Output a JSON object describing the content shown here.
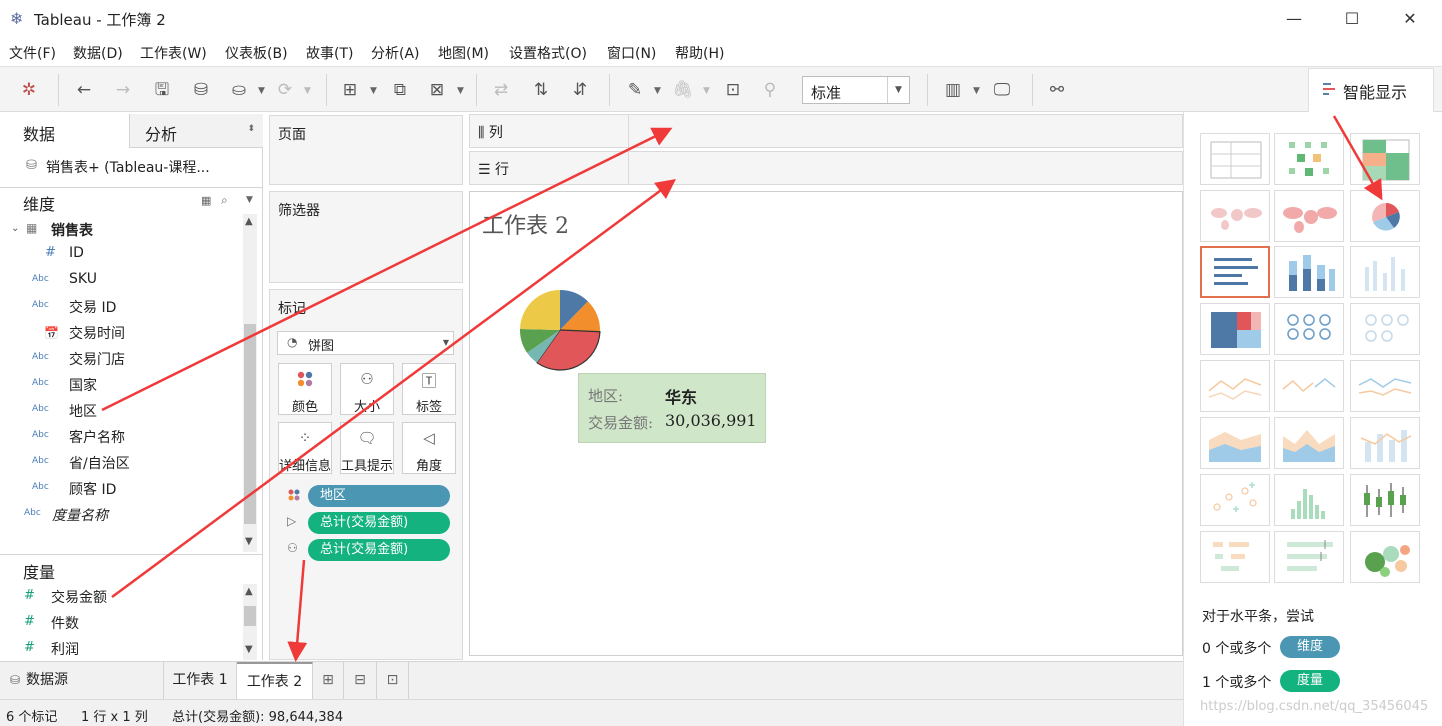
{
  "window": {
    "title": "Tableau - 工作簿 2",
    "minimize": "—",
    "maximize": "☐",
    "close": "✕"
  },
  "menu": [
    "文件(F)",
    "数据(D)",
    "工作表(W)",
    "仪表板(B)",
    "故事(T)",
    "分析(A)",
    "地图(M)",
    "设置格式(O)",
    "窗口(N)",
    "帮助(H)"
  ],
  "toolbar": {
    "fit_select": "标准",
    "smart_show": "智能显示"
  },
  "left": {
    "tab_data": "数据",
    "tab_analysis": "分析",
    "datasource": "销售表+ (Tableau-课程...",
    "dimensions_header": "维度",
    "table_name": "销售表",
    "dimensions": [
      {
        "type": "#",
        "name": "ID"
      },
      {
        "type": "Abc",
        "name": "SKU"
      },
      {
        "type": "Abc",
        "name": "交易 ID"
      },
      {
        "type": "date",
        "name": "交易时间"
      },
      {
        "type": "Abc",
        "name": "交易门店"
      },
      {
        "type": "Abc",
        "name": "国家"
      },
      {
        "type": "Abc",
        "name": "地区"
      },
      {
        "type": "Abc",
        "name": "客户名称"
      },
      {
        "type": "Abc",
        "name": "省/自治区"
      },
      {
        "type": "Abc",
        "name": "顾客 ID"
      }
    ],
    "measure_names": "度量名称",
    "measures_header": "度量",
    "measures": [
      "交易金额",
      "件数",
      "利润"
    ]
  },
  "shelves": {
    "pages": "页面",
    "filters": "筛选器",
    "marks": "标记",
    "mark_type": "饼图",
    "columns": "列",
    "rows": "行",
    "mark_buttons": [
      "颜色",
      "大小",
      "标签",
      "详细信息",
      "工具提示",
      "角度"
    ],
    "pills": [
      {
        "label": "地区",
        "color": "#4a96b3"
      },
      {
        "label": "总计(交易金额)",
        "color": "#14b27f"
      },
      {
        "label": "总计(交易金额)",
        "color": "#14b27f"
      }
    ]
  },
  "view": {
    "title": "工作表 2",
    "tooltip": {
      "label1": "地区:",
      "value1": "华东",
      "label2": "交易金额:",
      "value2": "30,036,991"
    }
  },
  "pie": {
    "slices": [
      {
        "name": "slice-blue",
        "value": 11,
        "color": "#4e79a7"
      },
      {
        "name": "slice-orange",
        "value": 12,
        "color": "#f28e2b"
      },
      {
        "name": "slice-red",
        "value": 30.5,
        "color": "#e15759"
      },
      {
        "name": "slice-teal",
        "value": 5,
        "color": "#76b7b2"
      },
      {
        "name": "slice-green",
        "value": 9,
        "color": "#59a14f"
      },
      {
        "name": "slice-yellow",
        "value": 22,
        "color": "#edc948"
      }
    ]
  },
  "smart_panel": {
    "hint": "对于水平条，尝试",
    "req1_prefix": "0 个或多个",
    "req1_pill": "维度",
    "req2_prefix": "1 个或多个",
    "req2_pill": "度量"
  },
  "tabs": {
    "datasource": "数据源",
    "sheet1": "工作表 1",
    "sheet2": "工作表 2"
  },
  "status": {
    "marks": "6 个标记",
    "grid": "1 行 x 1 列",
    "sum": "总计(交易金额): 98,644,384"
  },
  "watermark": "https://blog.csdn.net/qq_35456045"
}
